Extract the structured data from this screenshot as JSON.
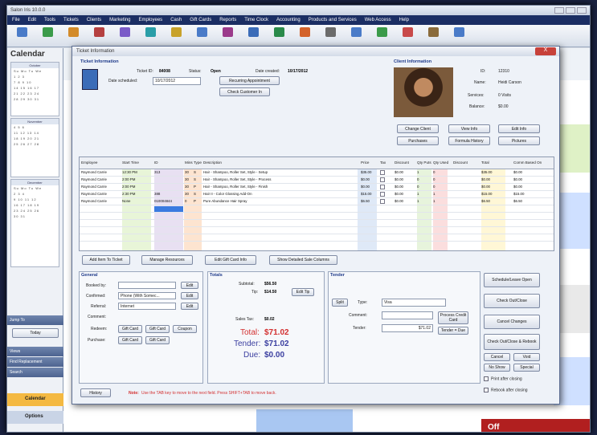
{
  "app": {
    "title": "Salon Iris 10.0.0",
    "menu": [
      "File",
      "Edit",
      "Tools",
      "Tickets",
      "Clients",
      "Marketing",
      "Employees",
      "Cash",
      "Gift Cards",
      "Reports",
      "Time Clock",
      "Accounting",
      "Products and Services",
      "Web Access",
      "Help"
    ]
  },
  "sidebar": {
    "title": "Calendar",
    "months": [
      "October",
      "November",
      "December"
    ],
    "nav": [
      "Jump To",
      "Today",
      "Views",
      "Find Replacement",
      "Search"
    ],
    "items": [
      "Calendar",
      "Options"
    ]
  },
  "modal": {
    "title": "Ticket Information",
    "close": "X",
    "ticket": {
      "section": "Ticket Information",
      "ticket_id_label": "Ticket ID:",
      "ticket_id": "84008",
      "status_label": "Status:",
      "status": "Open",
      "created_label": "Date created:",
      "created": "10/17/2012",
      "scheduled_label": "Date scheduled:",
      "scheduled": "10/17/2012",
      "recurring": "Recurring Appointment",
      "check_in": "Check Customer In"
    },
    "client": {
      "section": "Client Information",
      "id_label": "ID:",
      "id": "12310",
      "name_label": "Name:",
      "name": "Heidi Carson",
      "services_label": "Services:",
      "services": "0 Visits",
      "balance_label": "Balance:",
      "balance": "$0.00",
      "buttons": [
        "Change Client",
        "View Info",
        "Edit Info",
        "Purchases",
        "Formula History",
        "Pictures"
      ]
    },
    "grid": {
      "headers": [
        "Employee",
        "Start Time",
        "ID",
        "Mins",
        "Type",
        "Description",
        "Price",
        "Tax",
        "Discount",
        "Qty Puts",
        "Qty Used",
        "Discount",
        "Total",
        "Comm Based On"
      ],
      "rows": [
        [
          "Raymond Carrie",
          "12:30 PM",
          "313",
          "30",
          "S",
          "Hair - Shampoo, Roller Set, Style - Setup",
          "$35.00",
          "",
          "$0.00",
          "1",
          "0",
          "",
          "$35.00",
          "$0.00"
        ],
        [
          "Raymond Carrie",
          "2:00 PM",
          "",
          "30",
          "S",
          "Hair - Shampoo, Roller Set, Style - Process",
          "$0.00",
          "",
          "$0.00",
          "0",
          "0",
          "",
          "$0.00",
          "$0.00"
        ],
        [
          "Raymond Carrie",
          "2:00 PM",
          "",
          "30",
          "P",
          "Hair - Shampoo, Roller Set, Style - Finish",
          "$0.00",
          "",
          "$0.00",
          "0",
          "0",
          "",
          "$0.00",
          "$0.00"
        ],
        [
          "Raymond Carrie",
          "2:30 PM",
          "388",
          "30",
          "S",
          "Hair II - Color Glossing Add-On",
          "$15.00",
          "",
          "$0.00",
          "1",
          "1",
          "",
          "$15.00",
          "$15.00"
        ],
        [
          "Raymond Carrie",
          "None",
          "010004844",
          "0",
          "P",
          "Pure Abundance Hair Spray",
          "$6.50",
          "",
          "$0.00",
          "1",
          "1",
          "",
          "$6.50",
          "$6.50"
        ]
      ]
    },
    "grid_buttons": [
      "Add Item To Ticket",
      "Manage Resources",
      "Edit Gift Card Info",
      "Show Detailed Sale Columns"
    ],
    "general": {
      "section": "General",
      "booked_label": "Booked by:",
      "booked": "",
      "confirmed_label": "Confirmed:",
      "confirmed": "Phone (With Somec...",
      "referral_label": "Referral:",
      "referral": "Internet",
      "comment_label": "Comment:",
      "redeem_label": "Redeem:",
      "purchase_label": "Purchase:",
      "edit": "Edit",
      "gift_card": "Gift Card",
      "coupon": "Coupon"
    },
    "totals": {
      "section": "Totals",
      "subtotal_label": "Subtotal:",
      "subtotal": "$56.50",
      "tip_label": "Tip:",
      "tip": "$14.50",
      "edit_tip": "Edit Tip",
      "sales_tax_label": "Sales Tax:",
      "sales_tax": "$0.02",
      "total_label": "Total:",
      "total": "$71.02",
      "tender_label": "Tender:",
      "tender": "$71.02",
      "due_label": "Due:",
      "due": "$0.00"
    },
    "tender": {
      "section": "Tender",
      "split": "Split",
      "type_label": "Type:",
      "type": "Visa",
      "comment_label": "Comment:",
      "tender_label": "Tender:",
      "tender_value": "$71.02",
      "process": "Process Credit Card",
      "tender_due": "Tender = Due"
    },
    "actions": [
      "Schedule/Leave Open",
      "Check Out/Close",
      "Cancel Changes",
      "Check Out/Close & Rebook",
      "Cancel",
      "Void",
      "No Show",
      "Special"
    ],
    "checks": [
      "Print after closing",
      "Rebook after closing"
    ],
    "footer": {
      "history": "History",
      "note_label": "Note:",
      "note": "Use the TAB key to move to the next field. Press SHIFT+TAB to move back."
    }
  },
  "colors": {
    "accent": "#1e3a8a",
    "danger": "#d32f2f",
    "menu": "#1b2e63"
  }
}
